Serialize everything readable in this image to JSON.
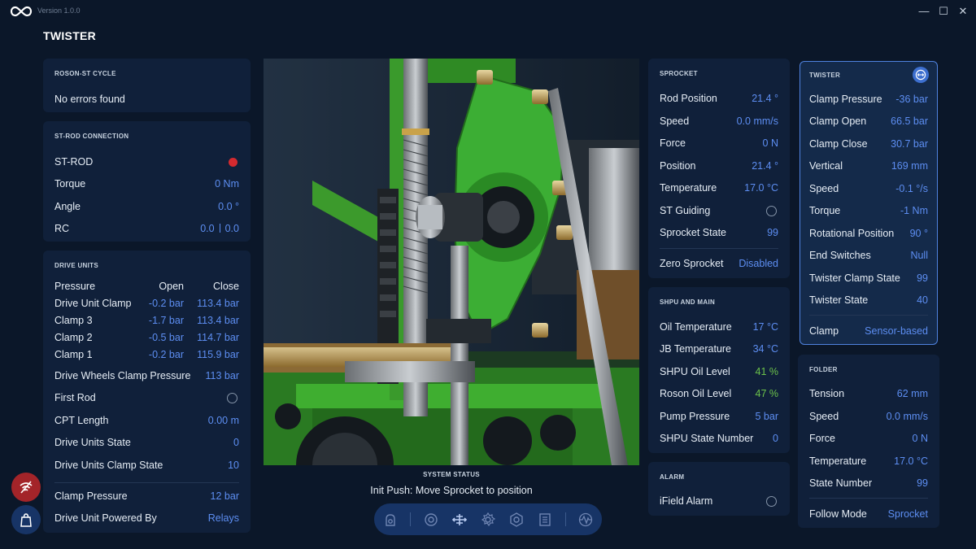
{
  "window": {
    "version": "Version 1.0.0",
    "app_title": "TWISTER",
    "minimize": "—",
    "maximize": "☐",
    "close": "✕"
  },
  "roson_cycle": {
    "title": "ROSON-ST CYCLE",
    "message": "No errors found"
  },
  "st_rod": {
    "title": "ST-ROD CONNECTION",
    "st_rod_label": "ST-ROD",
    "status_color": "#d42a2f",
    "torque": {
      "label": "Torque",
      "value": "0 Nm"
    },
    "angle": {
      "label": "Angle",
      "value": "0.0 °"
    },
    "rc": {
      "label": "RC",
      "value_a": "0.0",
      "value_b": "0.0"
    }
  },
  "drive_units": {
    "title": "DRIVE UNITS",
    "header": {
      "label": "Pressure",
      "open": "Open",
      "close": "Close"
    },
    "rows": [
      {
        "label": "Drive Unit Clamp",
        "open": "-0.2 bar",
        "close": "113.4 bar"
      },
      {
        "label": "Clamp 3",
        "open": "-1.7 bar",
        "close": "113.4 bar"
      },
      {
        "label": "Clamp 2",
        "open": "-0.5 bar",
        "close": "114.7 bar"
      },
      {
        "label": "Clamp 1",
        "open": "-0.2 bar",
        "close": "115.9 bar"
      }
    ],
    "wheels_pressure": {
      "label": "Drive Wheels Clamp Pressure",
      "value": "113 bar"
    },
    "first_rod": {
      "label": "First Rod"
    },
    "cpt_length": {
      "label": "CPT Length",
      "value": "0.00 m"
    },
    "state": {
      "label": "Drive Units State",
      "value": "0"
    },
    "clamp_state": {
      "label": "Drive Units Clamp State",
      "value": "10"
    },
    "clamp_pressure": {
      "label": "Clamp Pressure",
      "value": "12 bar"
    },
    "powered_by": {
      "label": "Drive Unit Powered By",
      "value": "Relays"
    }
  },
  "sprocket": {
    "title": "SPROCKET",
    "rows": [
      {
        "label": "Rod Position",
        "value": "21.4 °"
      },
      {
        "label": "Speed",
        "value": "0.0 mm/s"
      },
      {
        "label": "Force",
        "value": "0 N"
      },
      {
        "label": "Position",
        "value": "21.4 °"
      },
      {
        "label": "Temperature",
        "value": "17.0 °C"
      }
    ],
    "st_guiding": {
      "label": "ST Guiding"
    },
    "state": {
      "label": "Sprocket State",
      "value": "99"
    },
    "zero": {
      "label": "Zero Sprocket",
      "value": "Disabled"
    }
  },
  "shpu": {
    "title": "SHPU AND MAIN",
    "rows": [
      {
        "label": "Oil Temperature",
        "value": "17 °C"
      },
      {
        "label": "JB Temperature",
        "value": "34 °C"
      },
      {
        "label": "SHPU Oil Level",
        "value": "41 %"
      },
      {
        "label": "Roson Oil Level",
        "value": "47 %"
      },
      {
        "label": "Pump Pressure",
        "value": "5 bar"
      },
      {
        "label": "SHPU State Number",
        "value": "0"
      }
    ]
  },
  "alarm": {
    "title": "ALARM",
    "ifield": {
      "label": "iField Alarm"
    }
  },
  "twister": {
    "title": "TWISTER",
    "rows": [
      {
        "label": "Clamp Pressure",
        "value": "-36 bar"
      },
      {
        "label": "Clamp Open",
        "value": "66.5 bar"
      },
      {
        "label": "Clamp Close",
        "value": "30.7 bar"
      },
      {
        "label": "Vertical",
        "value": "169 mm"
      },
      {
        "label": "Speed",
        "value": "-0.1 °/s"
      },
      {
        "label": "Torque",
        "value": "-1 Nm"
      },
      {
        "label": "Rotational Position",
        "value": "90 °"
      },
      {
        "label": "End Switches",
        "value": "Null"
      },
      {
        "label": "Twister Clamp State",
        "value": "99"
      },
      {
        "label": "Twister State",
        "value": "40"
      }
    ],
    "clamp": {
      "label": "Clamp",
      "value": "Sensor-based"
    }
  },
  "folder": {
    "title": "FOLDER",
    "rows": [
      {
        "label": "Tension",
        "value": "62 mm"
      },
      {
        "label": "Speed",
        "value": "0.0 mm/s"
      },
      {
        "label": "Force",
        "value": "0 N"
      },
      {
        "label": "Temperature",
        "value": "17.0 °C"
      },
      {
        "label": "State Number",
        "value": "99"
      }
    ],
    "follow_mode": {
      "label": "Follow Mode",
      "value": "Sprocket"
    }
  },
  "system_status": {
    "title": "SYSTEM STATUS",
    "message": "Init Push: Move Sprocket to position"
  },
  "colors": {
    "accent": "#5d8ef2",
    "positive": "#6cc24a",
    "alert": "#d42a2f",
    "panel": "#10203a",
    "background": "#0b1729"
  },
  "toolbar_icons": [
    "roson-icon",
    "drive-units-icon",
    "sprocket-icon",
    "twister-icon",
    "folder-icon",
    "list-icon",
    "waveform-icon"
  ]
}
